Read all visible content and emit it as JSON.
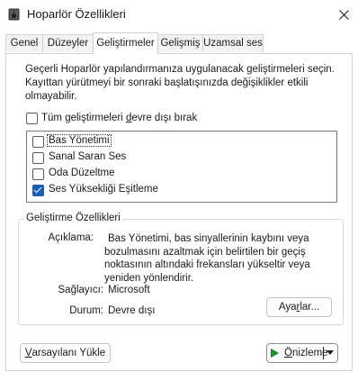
{
  "window": {
    "title": "Hoparlör Özellikleri",
    "icon": "speaker-icon",
    "close_icon": "close-icon"
  },
  "tabs": [
    {
      "label": "Genel",
      "active": false
    },
    {
      "label": "Düzeyler",
      "active": false
    },
    {
      "label": "Geliştirmeler",
      "active": true
    },
    {
      "label": "Gelişmiş",
      "active": false
    },
    {
      "label": "Uzamsal ses",
      "active": false
    }
  ],
  "enhancements": {
    "description": "Geçerli Hoparlör yapılandırmanıza uygulanacak geliştirmeleri seçin. Kayıttan yürütmeyi bir sonraki başlatışınızda değişiklikler etkili olmayabilir.",
    "disable_all": {
      "label_pre": "Tüm geliştirmeleri ",
      "label_underlined": "d",
      "label_post": "evre dışı bırak",
      "checked": false
    },
    "items": [
      {
        "label": "Bas Yönetimi",
        "checked": false,
        "focused": true
      },
      {
        "label": "Sanal Saran Ses",
        "checked": false,
        "focused": false
      },
      {
        "label": "Oda Düzeltme",
        "checked": false,
        "focused": false
      },
      {
        "label": "Ses Yüksekliği Eşitleme",
        "checked": true,
        "focused": false
      }
    ]
  },
  "properties": {
    "title": "Geliştirme Özellikleri",
    "description_label": "Açıklama:",
    "description_lines": [
      "Bas Yönetimi, bas sinyallerinin kaybını veya",
      "bozulmasını azaltmak için belirtilen bir geçiş",
      "noktasının altındaki frekansları yükseltir veya",
      "yeniden yönlendirir."
    ],
    "provider_label": "Sağlayıcı:",
    "provider_value": "Microsoft",
    "status_label": "Durum:",
    "status_value": "Devre dışı",
    "settings_button": {
      "pre": "Aya",
      "underlined": "r",
      "post": "lar..."
    }
  },
  "footer": {
    "restore_button": {
      "underlined": "V",
      "post": "arsayılanı Yükle"
    },
    "preview_button": {
      "icon": "play-icon",
      "underlined": "Ö",
      "post": "nizleme",
      "dropdown_icon": "dropdown-arrow-icon"
    }
  },
  "colors": {
    "accent": "#1a5fb4",
    "play_green": "#1e8a2e"
  }
}
